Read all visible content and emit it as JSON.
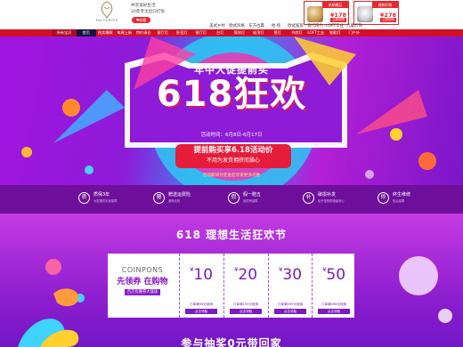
{
  "header": {
    "logo_text": "ENCOUNTER",
    "brand_line1": "共享美好生活",
    "brand_line2": "20年专注出口打伤",
    "fav_label": "收藏",
    "promos": [
      {
        "title": "热销爆品",
        "price": "¥178",
        "btn": "立即抢购"
      },
      {
        "title": "爆款好物",
        "price": "¥278",
        "btn": "立即抢购"
      }
    ],
    "categories": [
      "美式乡村",
      "欧式风格",
      "东方古典",
      "地·毯",
      "欧式家居",
      "现代简约",
      "LOFT工业",
      "儿童灯饰"
    ]
  },
  "nav": {
    "all_label": "所有宝贝",
    "items": [
      "首页",
      "热卖爆款",
      "每周上新",
      "特价清仓",
      "客厅灯",
      "卧室灯",
      "餐厅灯",
      "台灯",
      "落地灯",
      "吸顶灯",
      "壁灯",
      "书房灯",
      "LOFT工业",
      "智能灯",
      "门户外"
    ]
  },
  "banner": {
    "subtitle": "年中大促提前买",
    "headline": "618狂欢",
    "date": "活动时间：6月8日-6月17日",
    "red_line1": "提前购买享6.18活动价",
    "red_line2": "不用为发货拥挤而操心",
    "note": "活动期间付定金后享受更多优惠"
  },
  "guarantees": [
    {
      "icon": "质",
      "title": "质保3年",
      "desc": "为您提供无忧保障"
    },
    {
      "icon": "赠",
      "title": "赠送运费险",
      "desc": "退换无忧"
    },
    {
      "icon": "假",
      "title": "假一赔五",
      "desc": "品质有保障"
    },
    {
      "icon": "补",
      "title": "破损补发",
      "desc": "给予您的购物最安心"
    },
    {
      "icon": "修",
      "title": "终生维修",
      "desc": "售后保障"
    }
  ],
  "section_title": "618 理想生活狂欢节",
  "coupons": {
    "intro_en": "COINPONS",
    "intro_cn": "先领券 在购物",
    "intro_tag": "百万优惠券大放送",
    "items": [
      {
        "value": "10",
        "condition": "订单满99元使用",
        "btn": "点击领取"
      },
      {
        "value": "20",
        "condition": "订单满199元使用",
        "btn": "点击领取"
      },
      {
        "value": "30",
        "condition": "订单满399元使用",
        "btn": "点击领取"
      },
      {
        "value": "50",
        "condition": "订单满598元使用",
        "btn": "点击领取"
      }
    ]
  },
  "bottom_title": "参与抽奖0元带回家",
  "colors": {
    "nav_red": "#d30f28",
    "nav_active": "#16133e",
    "accent": "#e8272d",
    "purple": "#7a1cc0"
  }
}
